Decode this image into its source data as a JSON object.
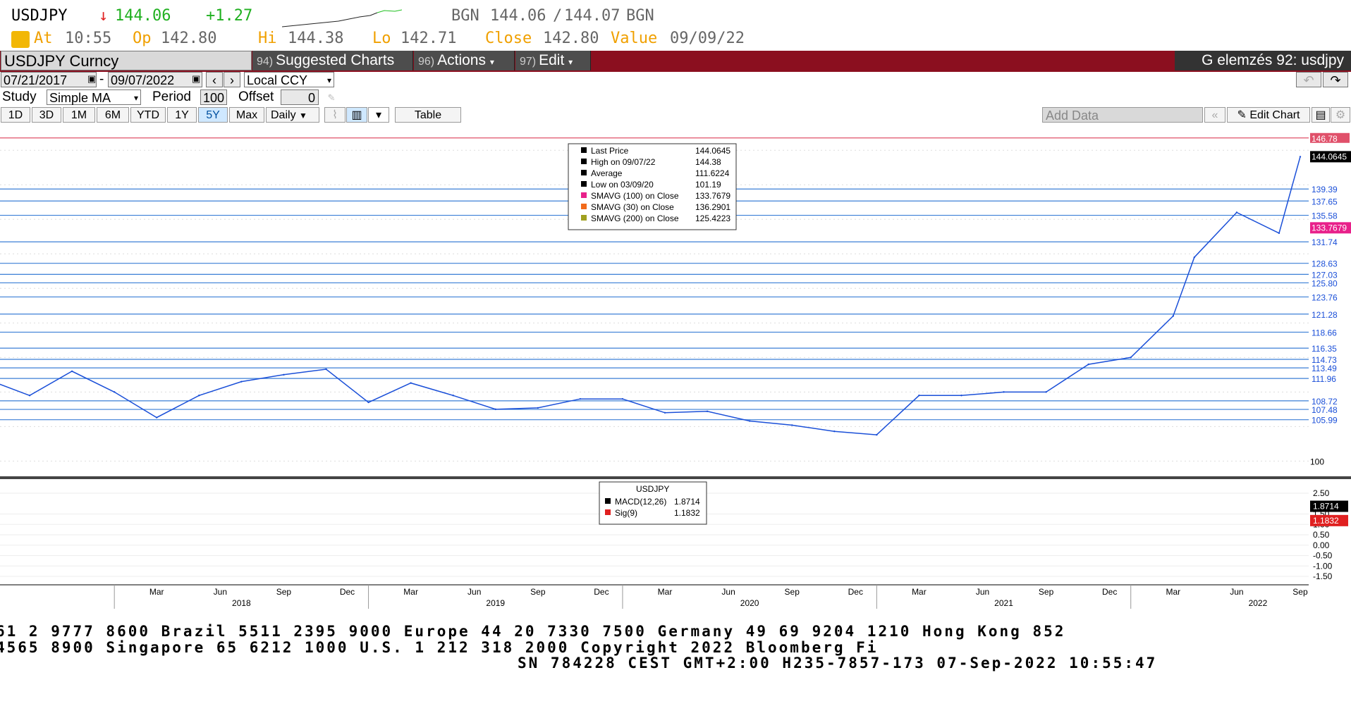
{
  "quote": {
    "symbol": "USDJPY",
    "last": "144.06",
    "change": "+1.27",
    "bgn_label": "BGN",
    "bid": "144.06",
    "ask": "144.07",
    "bgn_label2": "BGN",
    "at_label": "At",
    "at": "10:55",
    "op_label": "Op",
    "op": "142.80",
    "hi_label": "Hi",
    "hi": "144.38",
    "lo_label": "Lo",
    "lo": "142.71",
    "close_label": "Close",
    "close": "142.80",
    "value_label": "Value",
    "value": "09/09/22"
  },
  "menu": {
    "security": "USDJPY Curncy",
    "suggested_num": "94)",
    "suggested": "Suggested Charts",
    "actions_num": "96)",
    "actions": "Actions",
    "edit_num": "97)",
    "edit": "Edit",
    "group": "G elemzés 92: usdjpy"
  },
  "controls": {
    "date_from": "07/21/2017",
    "date_to": "09/07/2022",
    "currency": "Local CCY",
    "study_label": "Study",
    "study": "Simple MA",
    "period_label": "Period",
    "period": "100",
    "offset_label": "Offset",
    "offset": "0",
    "periods": [
      "1D",
      "3D",
      "1M",
      "6M",
      "YTD",
      "1Y",
      "5Y",
      "Max"
    ],
    "active_period": "5Y",
    "frequency": "Daily",
    "table_label": "Table",
    "add_data": "Add Data",
    "edit_chart": "Edit Chart"
  },
  "chart_data": {
    "type": "line",
    "title": "",
    "price_axis": {
      "min": 98,
      "max": 149,
      "ticks": [
        "100"
      ]
    },
    "price_levels": [
      "146.78",
      "139.39",
      "137.65",
      "135.58",
      "131.74",
      "128.63",
      "127.03",
      "125.80",
      "123.76",
      "121.28",
      "118.66",
      "116.35",
      "114.73",
      "113.49",
      "111.96",
      "108.72",
      "107.48",
      "105.99"
    ],
    "price_levels_hidden": [
      "147.72"
    ],
    "last_price_label": "144.0645",
    "sma100_label": "133.7679",
    "x_year_labels": [
      "2018",
      "2019",
      "2020",
      "2021",
      "2022"
    ],
    "x_month_labels": [
      "Mar",
      "Jun",
      "Sep",
      "Dec",
      "Mar",
      "Jun",
      "Sep",
      "Dec",
      "Mar",
      "Jun",
      "Sep",
      "Dec",
      "Mar",
      "Jun",
      "Sep",
      "Dec",
      "Mar",
      "Jun",
      "Sep"
    ],
    "series": [
      {
        "name": "Last Price",
        "color": "#1a4fd8",
        "x": [
          "2017-07",
          "2017-09",
          "2017-11",
          "2018-01",
          "2018-03",
          "2018-05",
          "2018-07",
          "2018-09",
          "2018-11",
          "2019-01",
          "2019-03",
          "2019-05",
          "2019-07",
          "2019-09",
          "2019-11",
          "2020-01",
          "2020-03",
          "2020-05",
          "2020-07",
          "2020-09",
          "2020-11",
          "2021-01",
          "2021-03",
          "2021-05",
          "2021-07",
          "2021-09",
          "2021-11",
          "2022-01",
          "2022-03",
          "2022-04",
          "2022-06",
          "2022-08",
          "2022-09"
        ],
        "y": [
          111.8,
          109.5,
          113.0,
          110.0,
          106.3,
          109.5,
          111.5,
          112.5,
          113.3,
          108.5,
          111.3,
          109.5,
          107.5,
          107.7,
          109.0,
          109.0,
          107.0,
          107.2,
          105.8,
          105.2,
          104.3,
          103.8,
          109.5,
          109.5,
          110.0,
          110.0,
          114.0,
          115.0,
          121.0,
          129.5,
          136.0,
          133.0,
          144.06
        ]
      }
    ],
    "legend": [
      {
        "label": "Last Price",
        "value": "144.0645",
        "color": "#000000"
      },
      {
        "label": "High on 09/07/22",
        "value": "144.38",
        "color": "#000000"
      },
      {
        "label": "Average",
        "value": "111.6224",
        "color": "#000000"
      },
      {
        "label": "Low on 03/09/20",
        "value": "101.19",
        "color": "#000000"
      },
      {
        "label": "SMAVG (100)  on Close",
        "value": "133.7679",
        "color": "#e8208a"
      },
      {
        "label": "SMAVG (30)  on Close",
        "value": "136.2901",
        "color": "#f26a1b"
      },
      {
        "label": "SMAVG (200)  on Close",
        "value": "125.4223",
        "color": "#a0a020"
      }
    ],
    "macd": {
      "title": "USDJPY",
      "axis": [
        "2.50",
        "1.50",
        "1.00",
        "0.50",
        "0.00",
        "-0.50",
        "-1.00",
        "-1.50"
      ],
      "axis_hidden": [
        "2.00"
      ],
      "legend": [
        {
          "label": "MACD(12,26)",
          "value": "1.8714",
          "color": "#000000"
        },
        {
          "label": "Sig(9)",
          "value": "1.1832",
          "color": "#e02020"
        }
      ],
      "macd_label": "1.8714",
      "sig_label": "1.1832"
    }
  },
  "footer": {
    "line1": "61 2 9777 8600 Brazil 5511 2395 9000 Europe 44 20 7330 7500 Germany 49 69 9204 1210 Hong Kong 852",
    "line2": " 4565 8900       Singapore 65 6212 1000       U.S. 1 212 318 2000        Copyright 2022 Bloomberg Fi",
    "line3": "SN 784228 CEST GMT+2:00 H235-7857-173 07-Sep-2022 10:55:47"
  }
}
